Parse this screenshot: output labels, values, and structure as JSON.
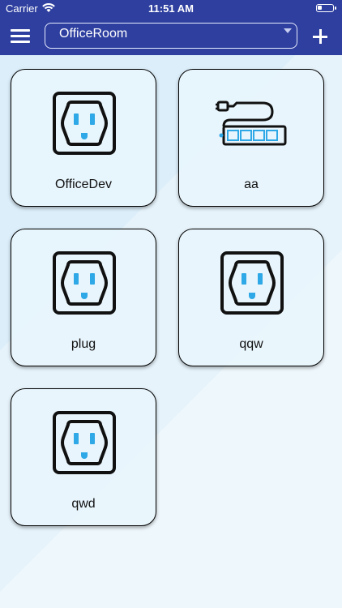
{
  "status_bar": {
    "carrier": "Carrier",
    "time": "11:51 AM"
  },
  "header": {
    "room_selected": "OfficeRoom",
    "icons": [
      "menu-icon",
      "dropdown-arrow-icon",
      "add-icon"
    ]
  },
  "devices": [
    {
      "name": "OfficeDev",
      "icon": "outlet-icon"
    },
    {
      "name": "aa",
      "icon": "power-strip-icon"
    },
    {
      "name": "plug",
      "icon": "outlet-icon"
    },
    {
      "name": "qqw",
      "icon": "outlet-icon"
    },
    {
      "name": "qwd",
      "icon": "outlet-icon"
    }
  ],
  "colors": {
    "header": "#2e3f9f",
    "outlet_slot": "#2ea8e6",
    "card_bg": "#e8f5fc"
  }
}
